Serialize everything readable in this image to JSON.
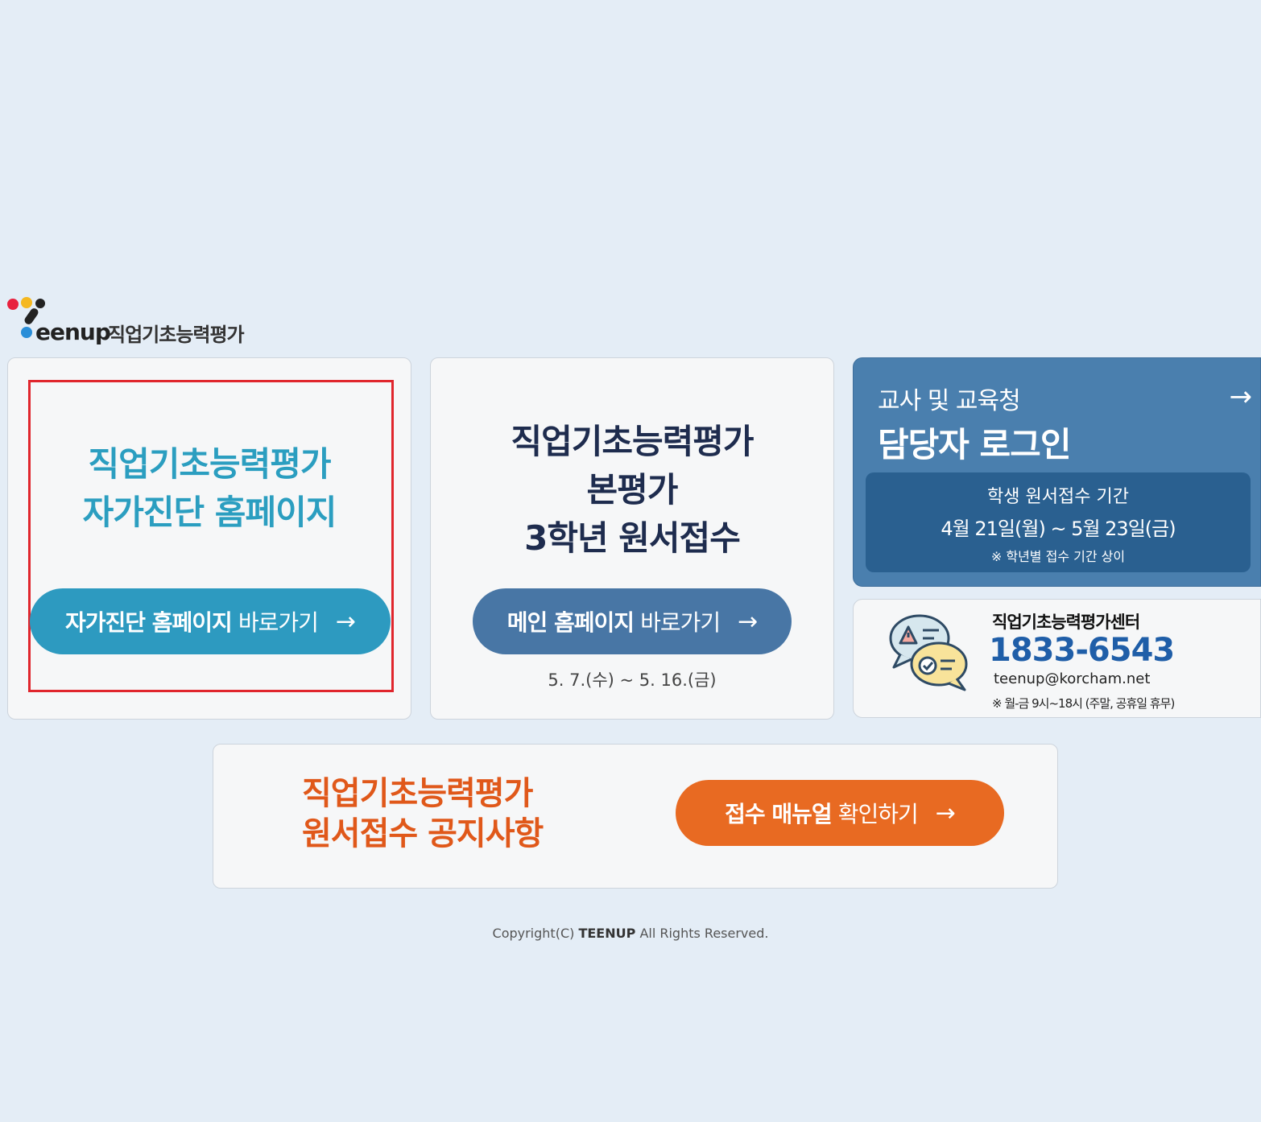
{
  "brand": {
    "word": "eenup",
    "subtitle": "직업기초능력평가",
    "dot_colors": [
      "#e8213e",
      "#f5b820",
      "#2a8ed8",
      "#222222"
    ]
  },
  "self_card": {
    "title_line1": "직업기초능력평가",
    "title_line2": "자가진단 홈페이지",
    "button_bold": "자가진단 홈페이지",
    "button_rest": "바로가기",
    "accent": "#2d9ac0"
  },
  "main_card": {
    "title_line1": "직업기초능력평가",
    "title_line2": "본평가",
    "title_line3": "3학년 원서접수",
    "button_bold": "메인 홈페이지",
    "button_rest": "바로가기",
    "dates": "5. 7.(수) ~ 5. 16.(금)"
  },
  "login_card": {
    "line1": "교사 및 교육청",
    "line2": "담당자 로그인",
    "period_title": "학생 원서접수 기간",
    "period_dates": "4월 21일(월) ~ 5월 23일(금)",
    "period_note": "※ 학년별 접수 기간 상이"
  },
  "center_card": {
    "name": "직업기초능력평가센터",
    "phone": "1833-6543",
    "email": "teenup@korcham.net",
    "hours": "※ 월-금 9시~18시 (주말, 공휴일 휴무)",
    "icon": "chat-bubbles-icon"
  },
  "notice_card": {
    "title_line1": "직업기초능력평가",
    "title_line2": "원서접수 공지사항",
    "button_bold": "접수 매뉴얼",
    "button_rest": "확인하기",
    "accent": "#e86a22"
  },
  "footer": {
    "prefix": "Copyright(C)",
    "brand": "TEENUP",
    "suffix": "All Rights Reserved."
  },
  "icons": {
    "arrow": "→"
  }
}
